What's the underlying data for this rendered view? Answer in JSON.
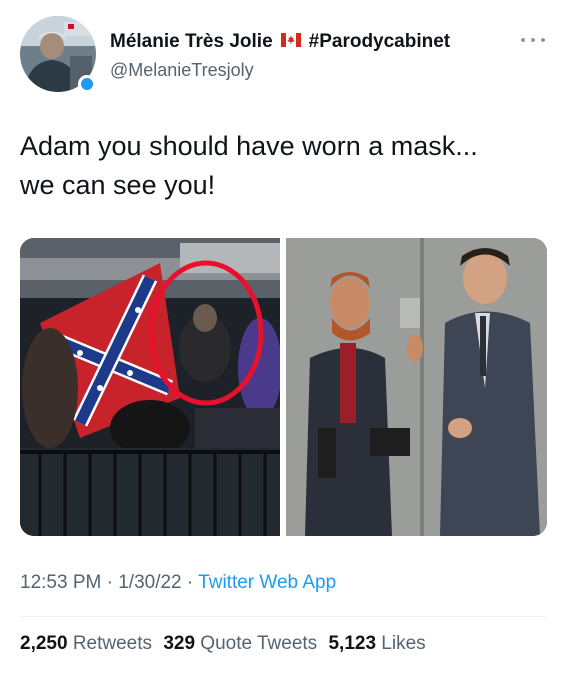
{
  "author": {
    "display_name": "Mélanie Très Jolie",
    "hashtag": "#Parodycabinet",
    "handle": "@MelanieTresjoly",
    "flag_icon": "canada-flag-icon",
    "more_icon": "more-options-icon"
  },
  "tweet": {
    "text_line1": "Adam you should have worn a mask...",
    "text_line2": "we can see you!"
  },
  "media": {
    "images": [
      "left-photo",
      "right-photo"
    ]
  },
  "meta": {
    "time": "12:53 PM",
    "separator1": " · ",
    "date": "1/30/22",
    "separator2": " · ",
    "app": "Twitter Web App"
  },
  "stats": {
    "retweets_count": "2,250",
    "retweets_label": "Retweets",
    "quotes_count": "329",
    "quotes_label": "Quote Tweets",
    "likes_count": "5,123",
    "likes_label": "Likes"
  },
  "colors": {
    "link": "#1d9bf0",
    "secondary_text": "#536471",
    "highlight_circle": "#e8112d"
  }
}
